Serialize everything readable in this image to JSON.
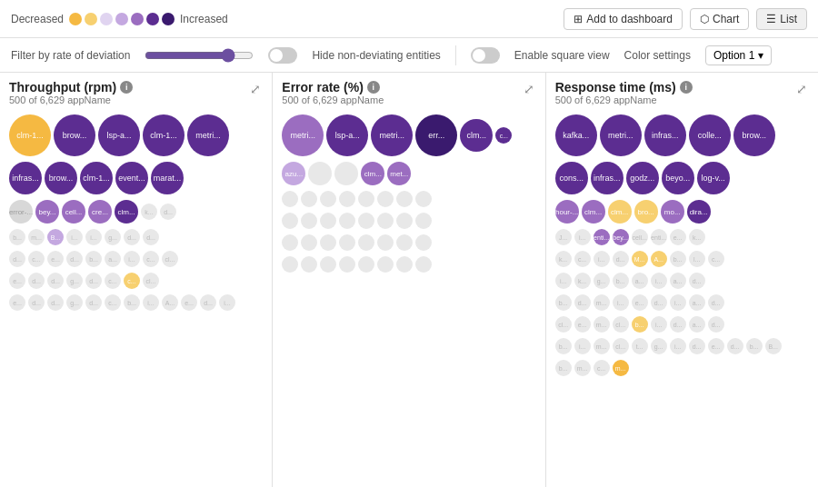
{
  "legend": {
    "decreased_label": "Decreased",
    "increased_label": "Increased",
    "dots": [
      {
        "color": "#f5b942"
      },
      {
        "color": "#f7d070"
      },
      {
        "color": "#e0d4f0"
      },
      {
        "color": "#c4a8e0"
      },
      {
        "color": "#9b6dc0"
      },
      {
        "color": "#5c2d91"
      },
      {
        "color": "#3a1a6e"
      }
    ]
  },
  "toolbar": {
    "add_dashboard_label": "Add to dashboard",
    "chart_label": "Chart",
    "list_label": "List"
  },
  "filter_bar": {
    "filter_label": "Filter by rate of deviation",
    "hide_label": "Hide non-deviating entities",
    "enable_label": "Enable square view",
    "color_settings_label": "Color settings",
    "option_label": "Option 1"
  },
  "panels": [
    {
      "title": "Throughput (rpm)",
      "subtitle": "500 of 6,629 appName"
    },
    {
      "title": "Error rate (%)",
      "subtitle": "500 of 6,629 appName"
    },
    {
      "title": "Response time (ms)",
      "subtitle": "500 of 6,629 appName"
    }
  ]
}
